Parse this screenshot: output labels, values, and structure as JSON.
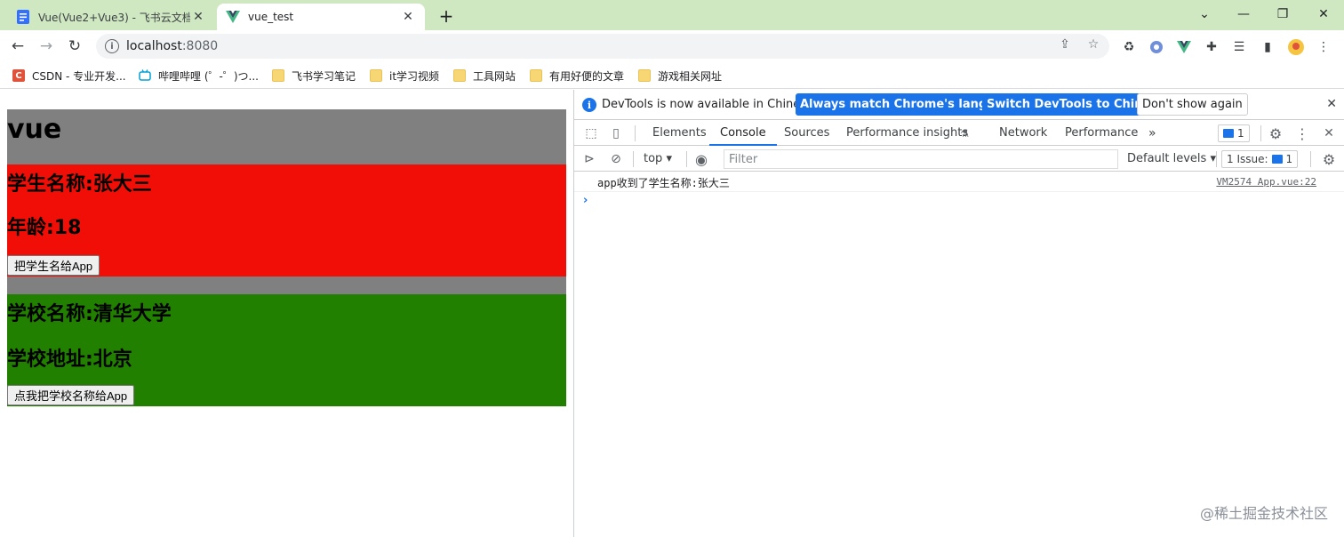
{
  "browser": {
    "tabs": [
      {
        "title": "Vue(Vue2+Vue3) - 飞书云文档",
        "active": false
      },
      {
        "title": "vue_test",
        "active": true
      }
    ],
    "new_tab": "+",
    "url_host": "localhost",
    "url_port": ":8080",
    "bookmarks": [
      {
        "label": "CSDN - 专业开发..."
      },
      {
        "label": "哔哩哔哩 (゜-゜)つ..."
      },
      {
        "label": "飞书学习笔记"
      },
      {
        "label": "it学习视频"
      },
      {
        "label": "工具网站"
      },
      {
        "label": "有用好便的文章"
      },
      {
        "label": "游戏相关网址"
      }
    ]
  },
  "page": {
    "app_title": "vue",
    "student": {
      "name": "学生名称:张大三",
      "age": "年龄:18",
      "button": "把学生名给App",
      "bg": "#f00e06"
    },
    "school": {
      "name": "学校名称:清华大学",
      "address": "学校地址:北京",
      "button": "点我把学校名称给App",
      "bg": "#228000"
    },
    "app_bg": "#808080"
  },
  "devtools": {
    "banner_text": "DevTools is now available in Chinese!",
    "btn_match": "Always match Chrome's language",
    "btn_switch": "Switch DevTools to Chinese",
    "btn_dismiss": "Don't show again",
    "tabs": [
      "Elements",
      "Console",
      "Sources",
      "Performance insights",
      "Network",
      "Performance"
    ],
    "active_tab": "Console",
    "more_tabs": "»",
    "issues_count": "1",
    "context": "top",
    "filter_placeholder": "Filter",
    "levels": "Default levels",
    "issue_label": "1 Issue:",
    "issue_count": "1",
    "log": {
      "message": "app收到了学生名称:张大三",
      "source": "VM2574 App.vue:22"
    },
    "prompt": "›"
  },
  "watermark": "@稀土掘金技术社区"
}
